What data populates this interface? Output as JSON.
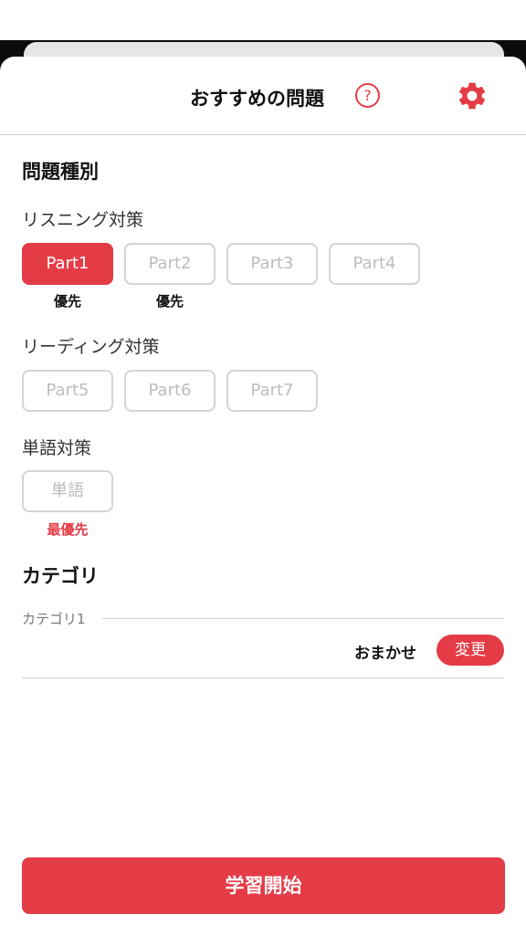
{
  "header": {
    "title": "おすすめの問題",
    "help_icon": "?"
  },
  "question_type": {
    "title": "問題種別",
    "listening": {
      "label": "リスニング対策",
      "parts": [
        {
          "label": "Part1",
          "selected": true,
          "note": "優先"
        },
        {
          "label": "Part2",
          "selected": false,
          "note": "優先"
        },
        {
          "label": "Part3",
          "selected": false,
          "note": ""
        },
        {
          "label": "Part4",
          "selected": false,
          "note": ""
        }
      ]
    },
    "reading": {
      "label": "リーディング対策",
      "parts": [
        {
          "label": "Part5",
          "selected": false
        },
        {
          "label": "Part6",
          "selected": false
        },
        {
          "label": "Part7",
          "selected": false
        }
      ]
    },
    "vocab": {
      "label": "単語対策",
      "parts": [
        {
          "label": "単語",
          "selected": false,
          "note": "最優先"
        }
      ]
    }
  },
  "category": {
    "title": "カテゴリ",
    "item_label": "カテゴリ1",
    "value": "おまかせ",
    "change_label": "変更"
  },
  "start_button": "学習開始",
  "colors": {
    "accent": "#e43c46",
    "chip_border": "#d4d4d4",
    "chip_text": "#bdbdbd"
  }
}
